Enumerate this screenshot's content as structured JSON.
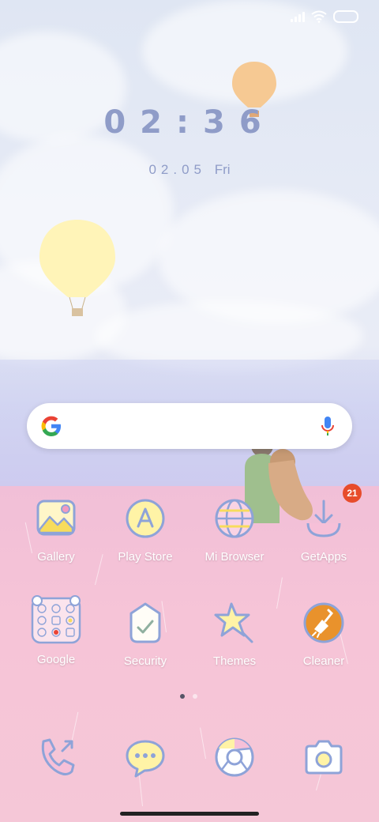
{
  "status_bar": {
    "signal_icon": "signal-icon",
    "wifi_icon": "wifi-icon",
    "battery_icon": "battery-icon"
  },
  "clock": {
    "time": "02:36",
    "date": "02.05",
    "weekday": "Fri"
  },
  "search": {
    "logo_icon": "google-g-icon",
    "mic_icon": "mic-icon"
  },
  "apps": [
    {
      "label": "Gallery",
      "icon": "gallery-icon"
    },
    {
      "label": "Play Store",
      "icon": "play-store-icon"
    },
    {
      "label": "Mi Browser",
      "icon": "browser-icon"
    },
    {
      "label": "GetApps",
      "icon": "getapps-icon",
      "badge": "21"
    },
    {
      "label": "Google",
      "icon": "folder-icon"
    },
    {
      "label": "Security",
      "icon": "security-icon"
    },
    {
      "label": "Themes",
      "icon": "themes-icon"
    },
    {
      "label": "Cleaner",
      "icon": "cleaner-icon"
    }
  ],
  "page_indicator": {
    "pages": 2,
    "current": 1
  },
  "dock": [
    {
      "icon": "phone-icon"
    },
    {
      "icon": "messages-icon"
    },
    {
      "icon": "chrome-icon"
    },
    {
      "icon": "camera-icon"
    }
  ],
  "colors": {
    "icon_stroke": "#8ea3d8",
    "badge": "#e74c2b",
    "cleaner": "#e9922c"
  }
}
